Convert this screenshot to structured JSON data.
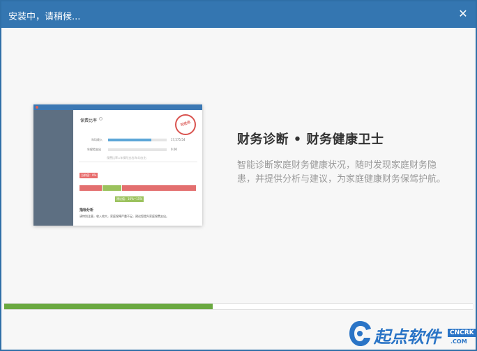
{
  "window": {
    "title": "安装中，请稍候...",
    "close_symbol": "✕"
  },
  "preview": {
    "title": "保费比率",
    "stamp": "可优化",
    "row1_label": "年均收入",
    "row1_value": "17,575.54",
    "row2_label": "年保险支出",
    "row2_value": "0.00",
    "note": "保费比率=年保险支出/年均支出",
    "tag_current": "当前值：0%",
    "tag_suggest": "建议值：10%~15%",
    "analysis_title": "指标分析",
    "analysis_text": "请特别注意，收入较大，家庭保障严重不足，建议您提升家庭保费支出。",
    "income_fill_fraction": 0.74
  },
  "feature": {
    "heading": "财务诊断 • 财务健康卫士",
    "description": "智能诊断家庭财务健康状况，随时发现家庭财务隐患，并提供分析与建议，为家庭健康财务保驾护航。"
  },
  "progress": {
    "fraction": 0.445,
    "color": "#6aa940"
  },
  "logo": {
    "text": "起点软件",
    "badge": "CNCRK",
    "domain": ".COM"
  },
  "colors": {
    "titlebar": "#3476b1",
    "accent": "#2a74c6"
  }
}
